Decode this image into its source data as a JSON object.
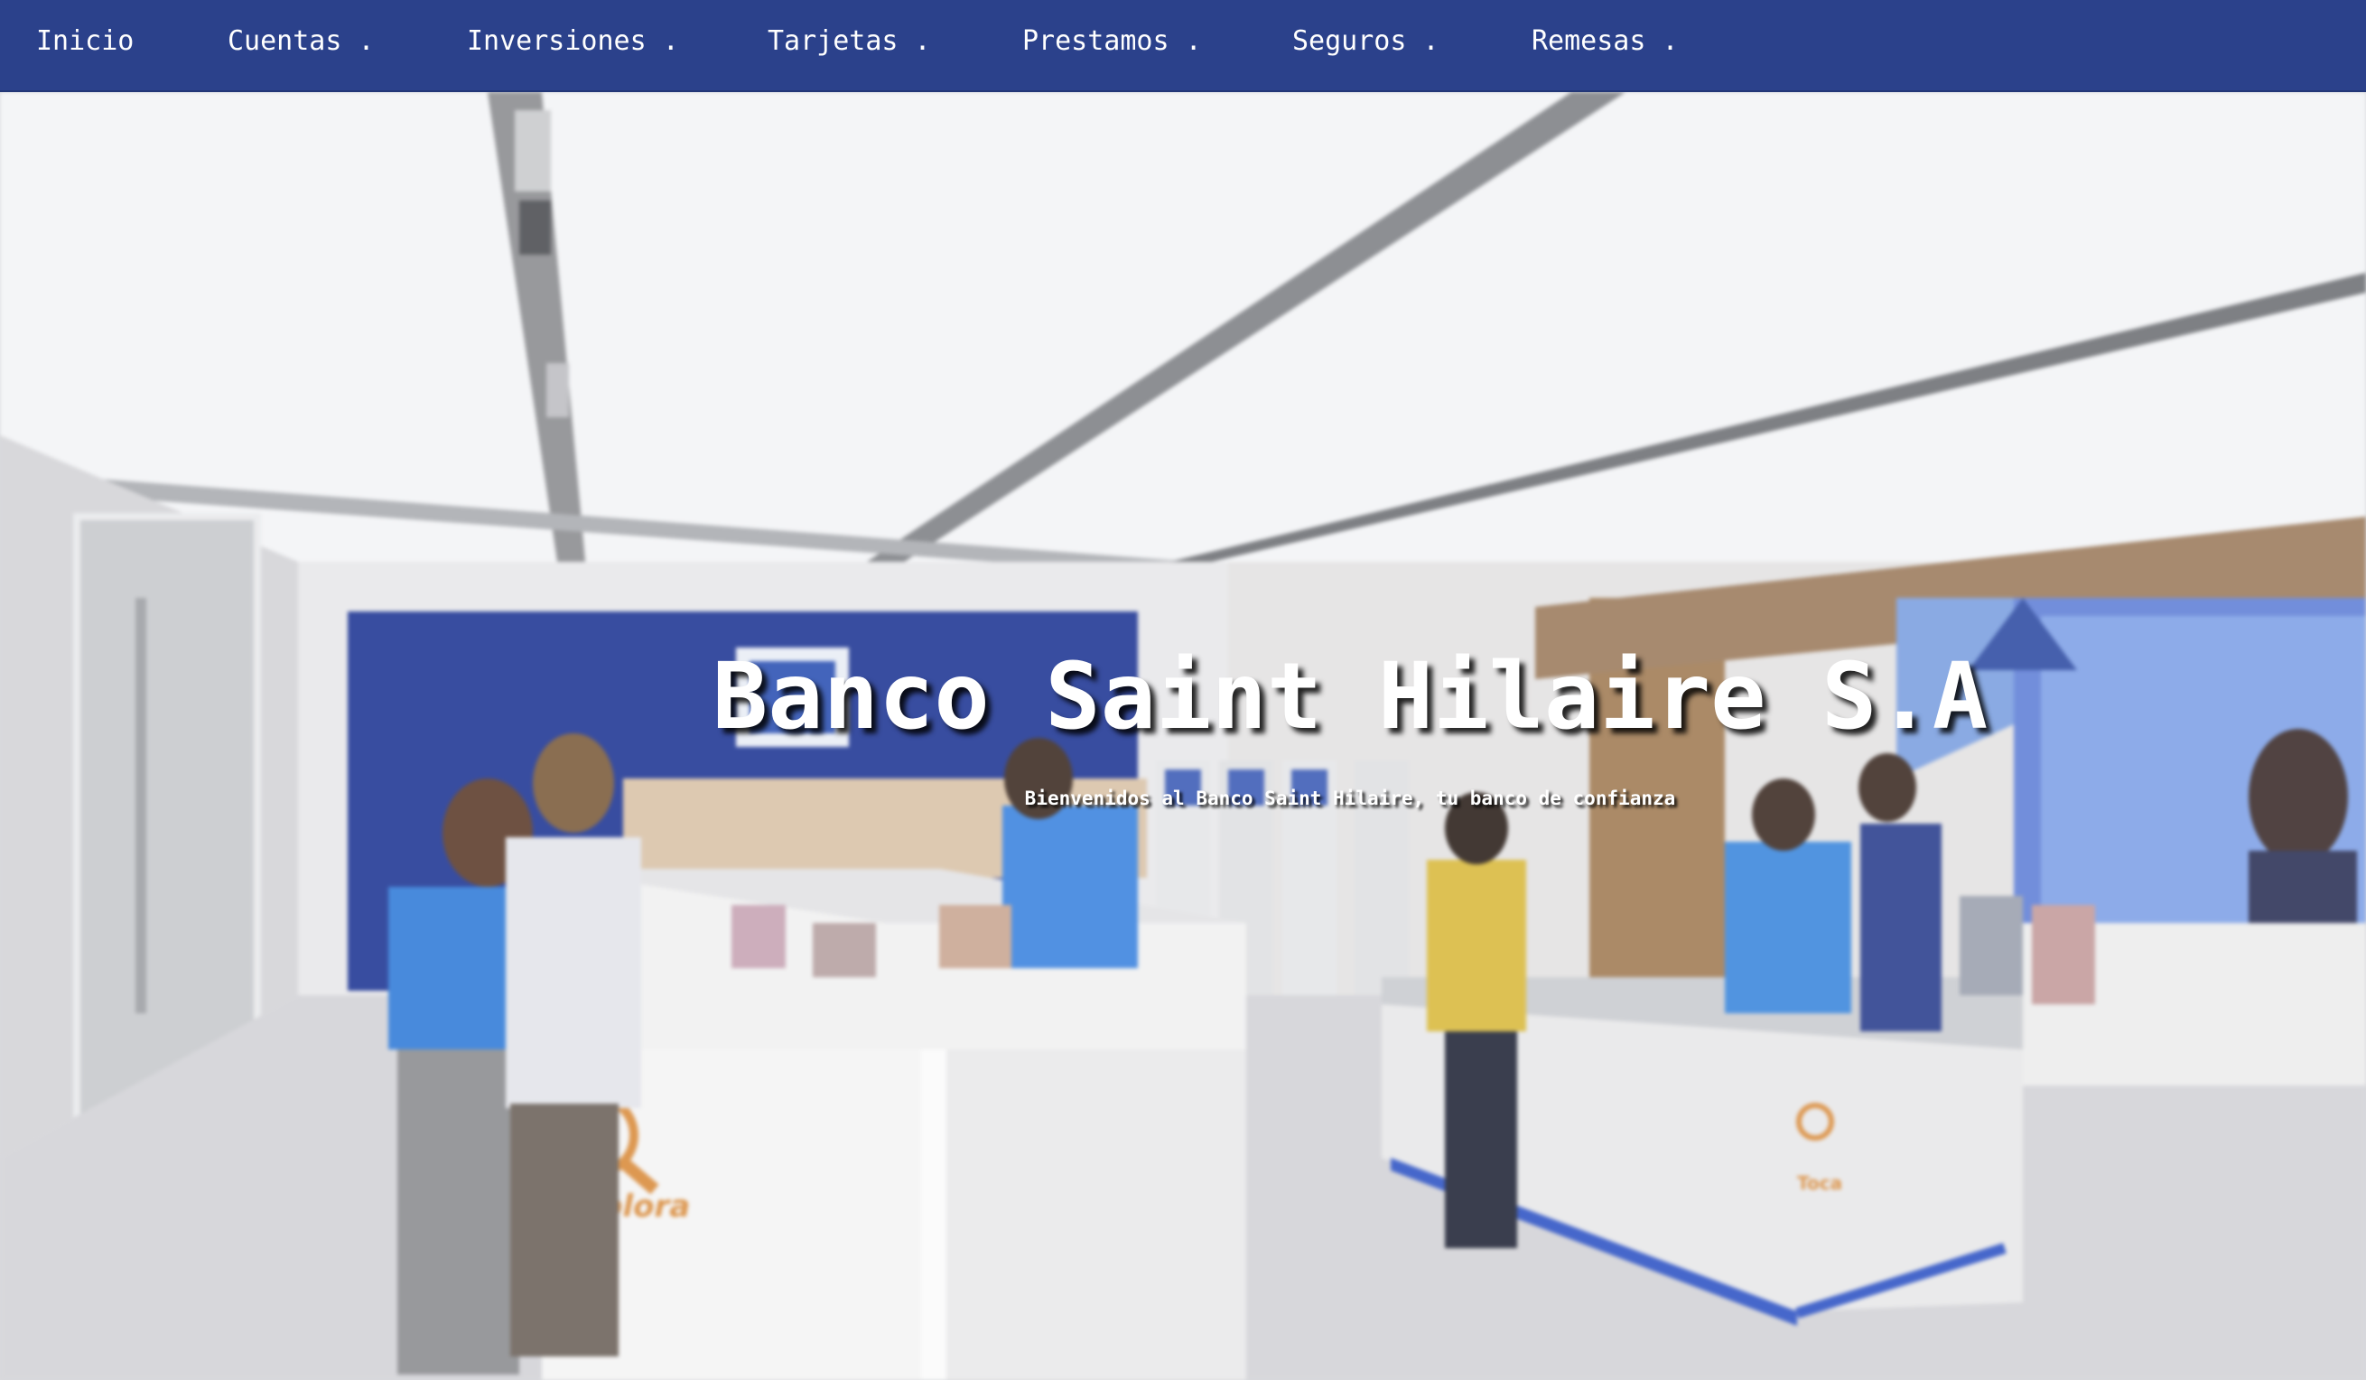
{
  "nav": {
    "items": [
      {
        "label": "Inicio"
      },
      {
        "label": "Cuentas ."
      },
      {
        "label": "Inversiones ."
      },
      {
        "label": "Tarjetas ."
      },
      {
        "label": "Prestamos ."
      },
      {
        "label": "Seguros ."
      },
      {
        "label": "Remesas ."
      }
    ]
  },
  "hero": {
    "title": "Banco Saint Hilaire S.A",
    "subtitle": "Bienvenidos al Banco Saint Hilaire, tu banco de confianza",
    "image": {
      "signage_left": "Explora",
      "signage_right": "Toca"
    }
  },
  "colors": {
    "nav_background": "#2b418b",
    "nav_text": "#ffffff",
    "brand_blue": "#1a3a9e",
    "signage_orange": "#d98a3a"
  }
}
